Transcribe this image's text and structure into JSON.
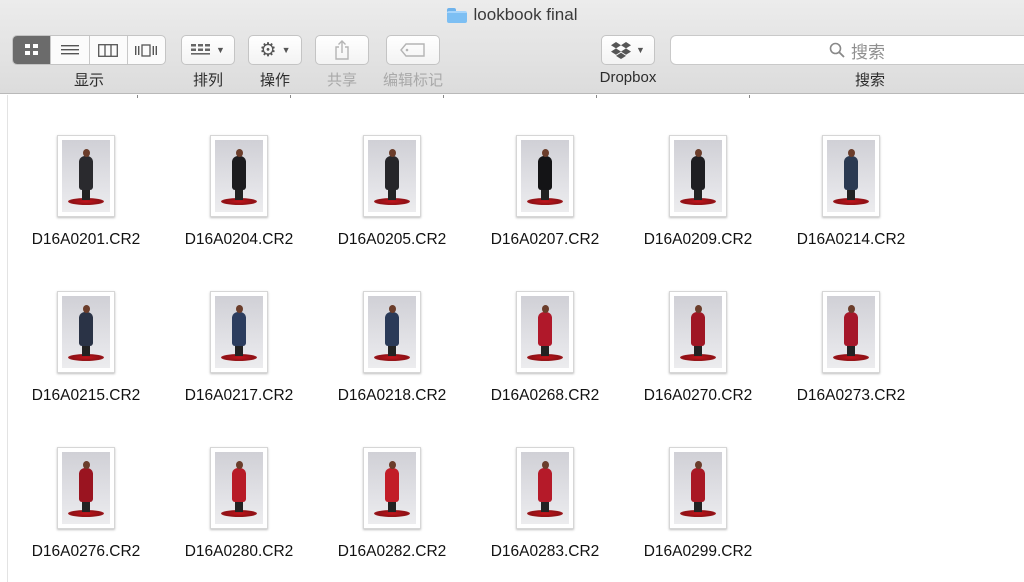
{
  "window": {
    "title": "lookbook final"
  },
  "toolbar": {
    "view_label": "显示",
    "arrange_label": "排列",
    "action_label": "操作",
    "share_label": "共享",
    "tags_label": "编辑标记",
    "dropbox_label": "Dropbox",
    "search_label": "搜索",
    "search_placeholder": "搜索"
  },
  "files": [
    {
      "name": "D16A0201.CR2",
      "outfit": "#2a2a2e"
    },
    {
      "name": "D16A0204.CR2",
      "outfit": "#1c1c1f"
    },
    {
      "name": "D16A0205.CR2",
      "outfit": "#26262a"
    },
    {
      "name": "D16A0207.CR2",
      "outfit": "#141416"
    },
    {
      "name": "D16A0209.CR2",
      "outfit": "#1e1e22"
    },
    {
      "name": "D16A0214.CR2",
      "outfit": "#2b3a52"
    },
    {
      "name": "D16A0215.CR2",
      "outfit": "#2a3346"
    },
    {
      "name": "D16A0217.CR2",
      "outfit": "#2c3d5e"
    },
    {
      "name": "D16A0218.CR2",
      "outfit": "#2a3a58"
    },
    {
      "name": "D16A0268.CR2",
      "outfit": "#b0182a"
    },
    {
      "name": "D16A0270.CR2",
      "outfit": "#9f1624"
    },
    {
      "name": "D16A0273.CR2",
      "outfit": "#a5172a"
    },
    {
      "name": "D16A0276.CR2",
      "outfit": "#9a1420"
    },
    {
      "name": "D16A0280.CR2",
      "outfit": "#b81b27"
    },
    {
      "name": "D16A0282.CR2",
      "outfit": "#c21d28"
    },
    {
      "name": "D16A0283.CR2",
      "outfit": "#b51a29"
    },
    {
      "name": "D16A0299.CR2",
      "outfit": "#a91824"
    }
  ]
}
